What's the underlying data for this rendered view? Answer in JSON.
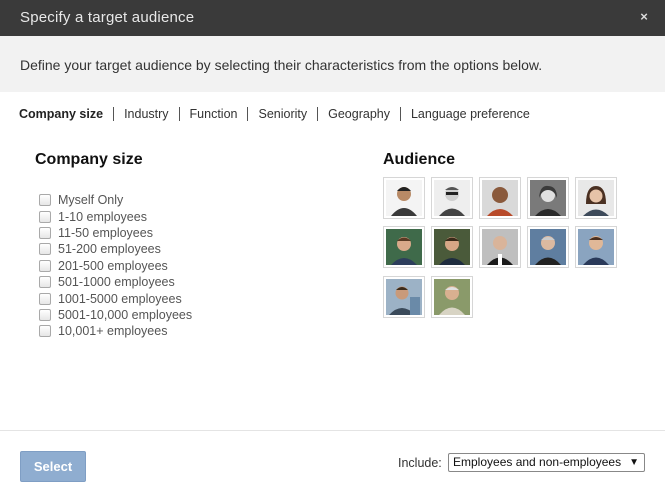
{
  "dialog": {
    "title": "Specify a target audience",
    "close_label": "×",
    "intro": "Define your target audience by selecting their characteristics from the options below."
  },
  "tabs": [
    "Company size",
    "Industry",
    "Function",
    "Seniority",
    "Geography",
    "Language preference"
  ],
  "company_size": {
    "heading": "Company size",
    "options": [
      "Myself Only",
      "1-10 employees",
      "11-50 employees",
      "51-200 employees",
      "201-500 employees",
      "501-1000 employees",
      "1001-5000 employees",
      "5001-10,000 employees",
      "10,001+ employees"
    ]
  },
  "audience": {
    "heading": "Audience",
    "avatar_count": 12
  },
  "footer": {
    "select_label": "Select",
    "include_label": "Include:",
    "include_value": "Employees and non-employees",
    "dropdown_arrow": "▼"
  }
}
